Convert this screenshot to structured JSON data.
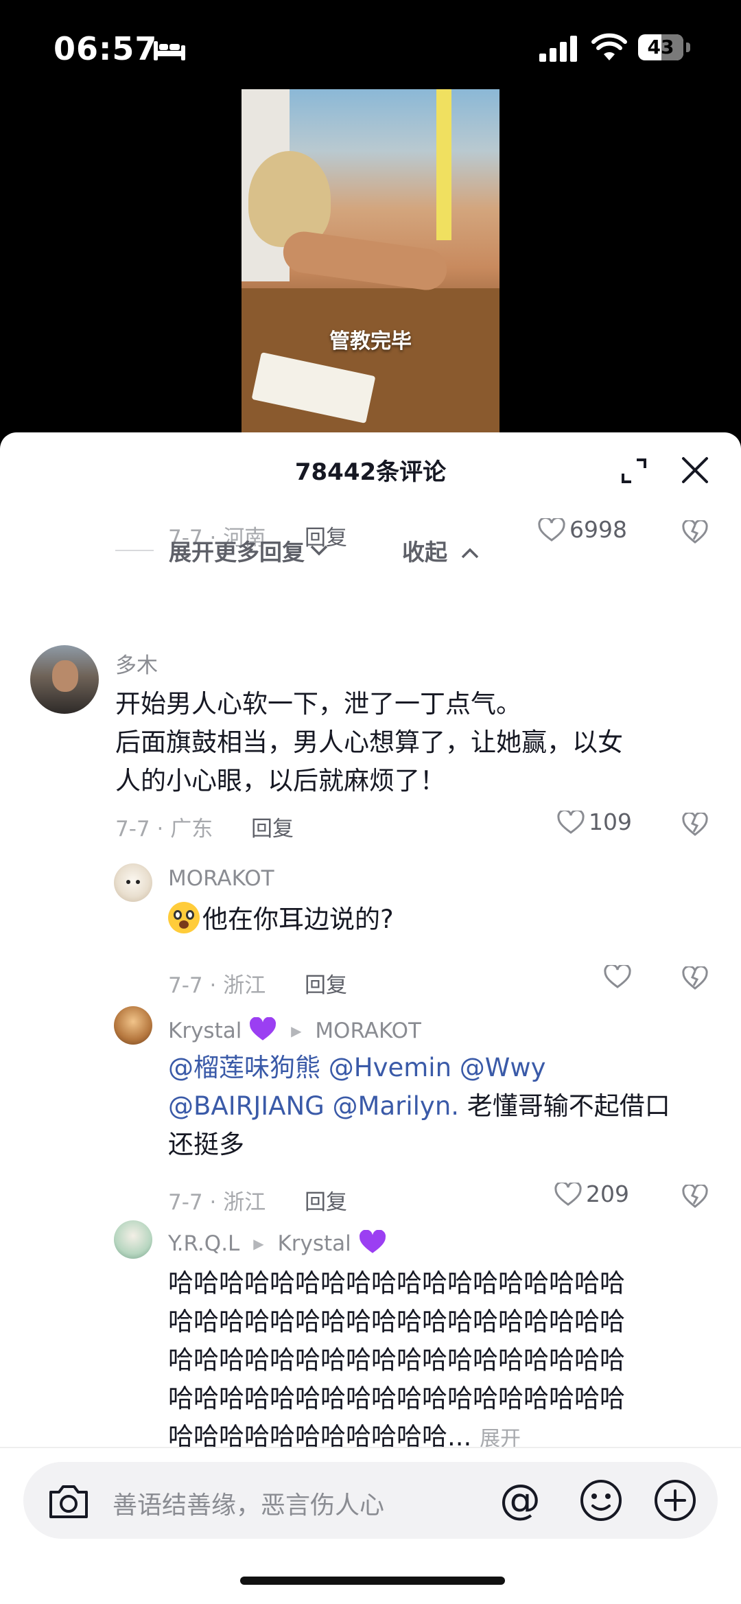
{
  "status_bar": {
    "time": "06:57",
    "battery": "43"
  },
  "video": {
    "caption": "管教完毕"
  },
  "sheet": {
    "title": "78442条评论"
  },
  "top_reply": {
    "date": "7-7 · 河南",
    "reply": "回复",
    "likes": "6998"
  },
  "thread": {
    "more_replies": "展开更多回复",
    "collapse": "收起"
  },
  "comment": {
    "user": "多木",
    "text_line1": "开始男人心软一下，泄了一丁点气。",
    "text_line2": "后面旗鼓相当，男人心想算了，让她赢，以女",
    "text_line3": "人的小心眼，以后就麻烦了！",
    "date": "7-7 · 广东",
    "reply": "回复",
    "likes": "109"
  },
  "replies": [
    {
      "user": "MORAKOT",
      "text": "他在你耳边说的?",
      "date": "7-7 · 浙江",
      "reply": "回复"
    },
    {
      "user": "Krystal",
      "to": "MORAKOT",
      "mentions_line1": "@榴莲味狗熊 @Hvemin @Wwy",
      "mentions_line2": "@BAIRJIANG @Marilyn.",
      "text_line2_rest": " 老懂哥输不起借口",
      "text_line3": "还挺多",
      "date": "7-7 · 浙江",
      "reply": "回复",
      "likes": "209"
    },
    {
      "user": "Y.R.Q.L",
      "to": "Krystal",
      "line1": "哈哈哈哈哈哈哈哈哈哈哈哈哈哈哈哈哈哈",
      "line2": "哈哈哈哈哈哈哈哈哈哈哈哈哈哈哈哈哈哈",
      "line3": "哈哈哈哈哈哈哈哈哈哈哈哈哈哈哈哈哈哈",
      "line4": "哈哈哈哈哈哈哈哈哈哈哈哈哈哈哈哈哈哈",
      "line5": "哈哈哈哈哈哈哈哈哈哈哈...",
      "expand": "展开"
    }
  ],
  "input": {
    "placeholder": "善语结善缘，恶言伤人心",
    "at": "@"
  },
  "icons": [
    "bed-icon",
    "signal-icon",
    "wifi-icon",
    "battery-icon",
    "expand-icon",
    "close-icon",
    "heart-icon",
    "dislike-icon",
    "chevron-down-icon",
    "chevron-up-icon",
    "camera-icon",
    "at-icon",
    "smile-icon",
    "plus-icon",
    "purple-heart-icon"
  ]
}
